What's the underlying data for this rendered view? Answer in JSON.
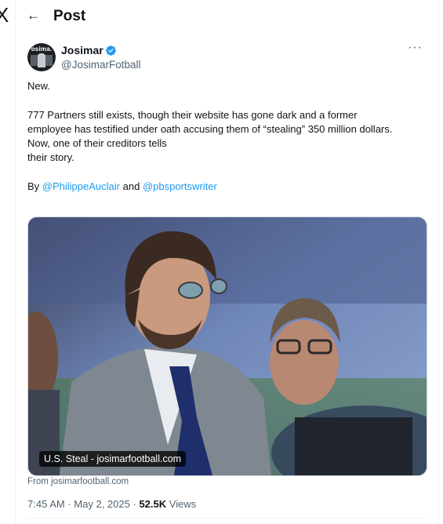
{
  "nav": {
    "logo_icon": "x-logo",
    "logo_glyph": "X"
  },
  "header": {
    "back_icon": "arrow-left-icon",
    "back_glyph": "←",
    "title": "Post"
  },
  "post": {
    "author_name": "Josimar",
    "avatar_text": "osima.",
    "verified_icon": "verified-badge-icon",
    "handle": "@JosimarFotball",
    "more_glyph": "···",
    "line1": "New.",
    "para_line1": "777 Partners still exists, though their website has gone dark and a former",
    "para_line2": "employee has testified under oath accusing them of “stealing” 350 million dollars.",
    "para_line3": "Now, one of their creditors tells",
    "para_line4": "their story.",
    "byline_prefix": "By",
    "mention1": "@PhilippeAuclair",
    "byline_and": "and",
    "mention2": "@pbsportswriter"
  },
  "media": {
    "card_label": "U.S. Steal - josimarfootball.com",
    "source": "From josimarfootball.com"
  },
  "meta": {
    "time": "7:45 AM",
    "sep1": "·",
    "date": "May 2, 2025",
    "sep2": "·",
    "views_count": "52.5K",
    "views_label": "Views"
  },
  "colors": {
    "accent": "#1d9bf0",
    "secondary_text": "#536471",
    "primary_text": "#0f1419"
  }
}
